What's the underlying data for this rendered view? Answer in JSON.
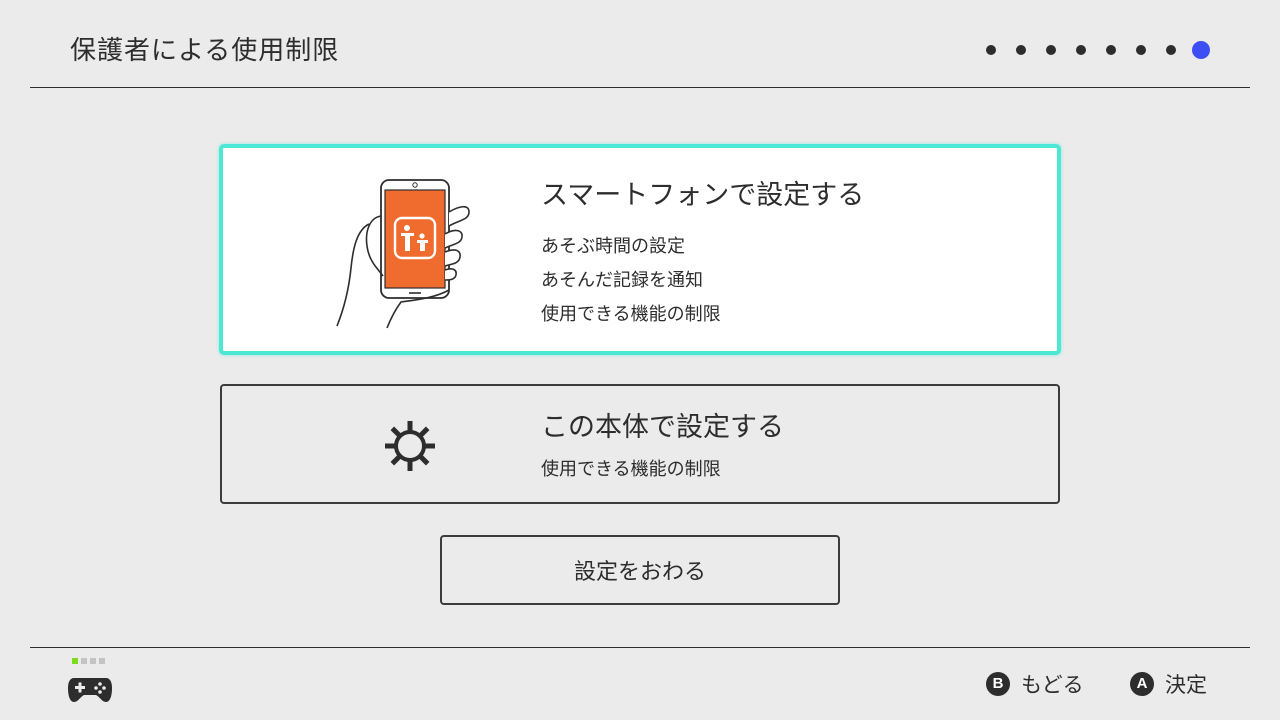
{
  "header": {
    "title": "保護者による使用制限",
    "progress": {
      "total_steps": 8,
      "current_step": 8
    }
  },
  "options": [
    {
      "title": "スマートフォンで設定する",
      "lines": [
        "あそぶ時間の設定",
        "あそんだ記録を通知",
        "使用できる機能の制限"
      ],
      "icon": "smartphone-parental-controls-icon",
      "selected": true
    },
    {
      "title": "この本体で設定する",
      "lines": [
        "使用できる機能の制限"
      ],
      "icon": "gear-icon",
      "selected": false
    }
  ],
  "finish_button": {
    "label": "設定をおわる"
  },
  "footer": {
    "controller": {
      "icon": "controller-icon",
      "player_indicator": 1,
      "indicator_slots": 4
    },
    "actions": [
      {
        "button": "B",
        "label": "もどる"
      },
      {
        "button": "A",
        "label": "決定"
      }
    ]
  },
  "colors": {
    "background": "#ebebeb",
    "text": "#2d2d2d",
    "selection_border": "#4be8d6",
    "progress_active": "#3d4ff2",
    "app_icon_orange": "#f06b2e",
    "player_indicator": "#7ddc1e"
  }
}
